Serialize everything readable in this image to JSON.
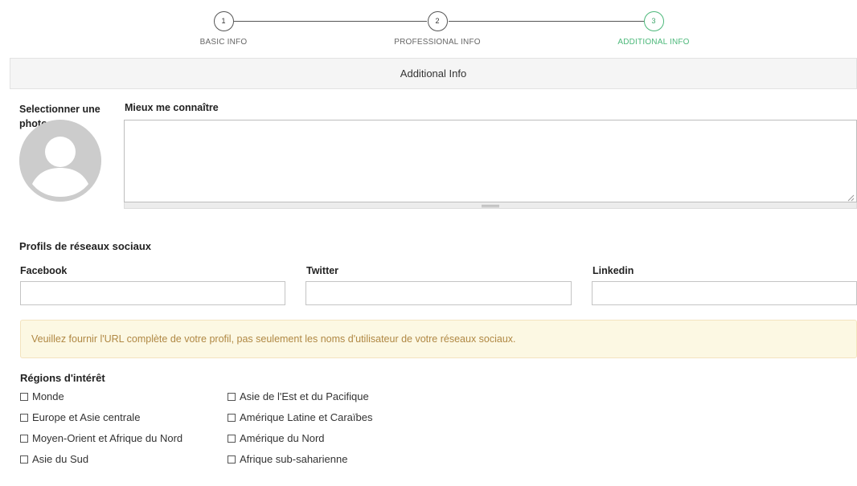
{
  "stepper": {
    "steps": [
      {
        "number": "1",
        "label": "BASIC INFO"
      },
      {
        "number": "2",
        "label": "PROFESSIONAL INFO"
      },
      {
        "number": "3",
        "label": "ADDITIONAL INFO"
      }
    ],
    "active_color": "#4cb87a"
  },
  "section": {
    "title": "Additional Info"
  },
  "photo": {
    "label": "Selectionner une photo"
  },
  "about": {
    "label": "Mieux me connaître",
    "value": ""
  },
  "social": {
    "title": "Profils de réseaux sociaux",
    "facebook": {
      "label": "Facebook",
      "value": ""
    },
    "twitter": {
      "label": "Twitter",
      "value": ""
    },
    "linkedin": {
      "label": "Linkedin",
      "value": ""
    }
  },
  "alert": {
    "text": "Veuillez fournir l'URL complète de votre profil, pas seulement les noms d'utilisateur de votre réseaux sociaux.",
    "color": "#b08844",
    "background": "#fcf8e3"
  },
  "regions": {
    "title": "Régions d'intérêt",
    "col1": [
      "Monde",
      "Europe et Asie centrale",
      "Moyen-Orient et Afrique du Nord",
      "Asie du Sud"
    ],
    "col2": [
      "Asie de l'Est et du Pacifique",
      "Amérique Latine et Caraïbes",
      "Amérique du Nord",
      "Afrique sub-saharienne"
    ]
  }
}
